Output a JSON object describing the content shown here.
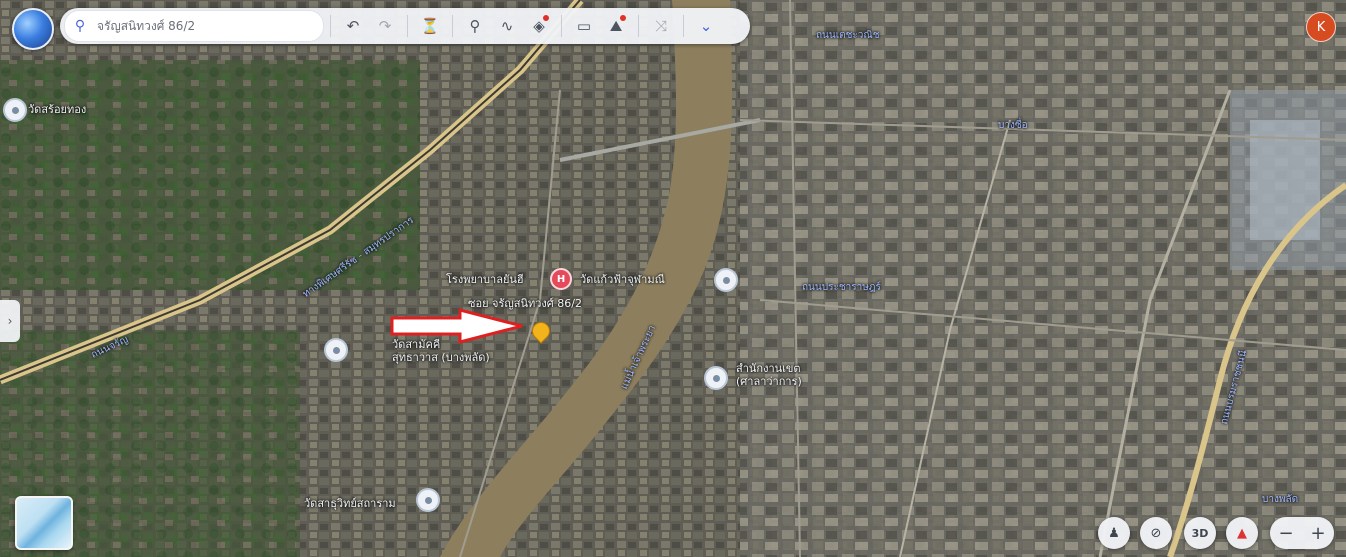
{
  "toolbar": {
    "search_value": "จรัญสนิทวงศ์ 86/2",
    "avatar_initial": "K"
  },
  "labels": {
    "temple_top_left": "วัดสร้อยทอง",
    "temple_left": "วัดสามัคคี\nสุทธาวาส (บางพลัด)",
    "hospital": "โรงพยาบาลยันฮี",
    "temple_river_west": "วัดแก้วฟ้าจุฬามณี",
    "soi": "ซอย จรัญสนิทวงศ์ 86/2",
    "temple_east": "สำนักงานเขต\n(ศาลาว่าการ)",
    "temple_bottom": "วัดสาธุวิทย์สถาราม",
    "road_vertical": "ถนนบรมราชชนนี",
    "bridge_road": "ทางพิเศษศรีรัช - สมุทรปราการ",
    "district_right": "บางซื่อ",
    "bottom_right": "บางพลัด",
    "left_bottom_road": "ถนนจรัญ",
    "river_label": "แม่น้ำเจ้าพระยา",
    "east_road": "ถนนประชาราษฎร์",
    "top_road": "ถนนเตชะวณิช"
  },
  "controls": {
    "tilt_label": "3D",
    "zoom_out": "−",
    "zoom_in": "+"
  },
  "colors": {
    "river": "#8d7f5e",
    "elevated_road": "#d9c48a",
    "urban": "#6d6b61",
    "vegetation": "#3f5b34",
    "arrow": "#e02020"
  }
}
